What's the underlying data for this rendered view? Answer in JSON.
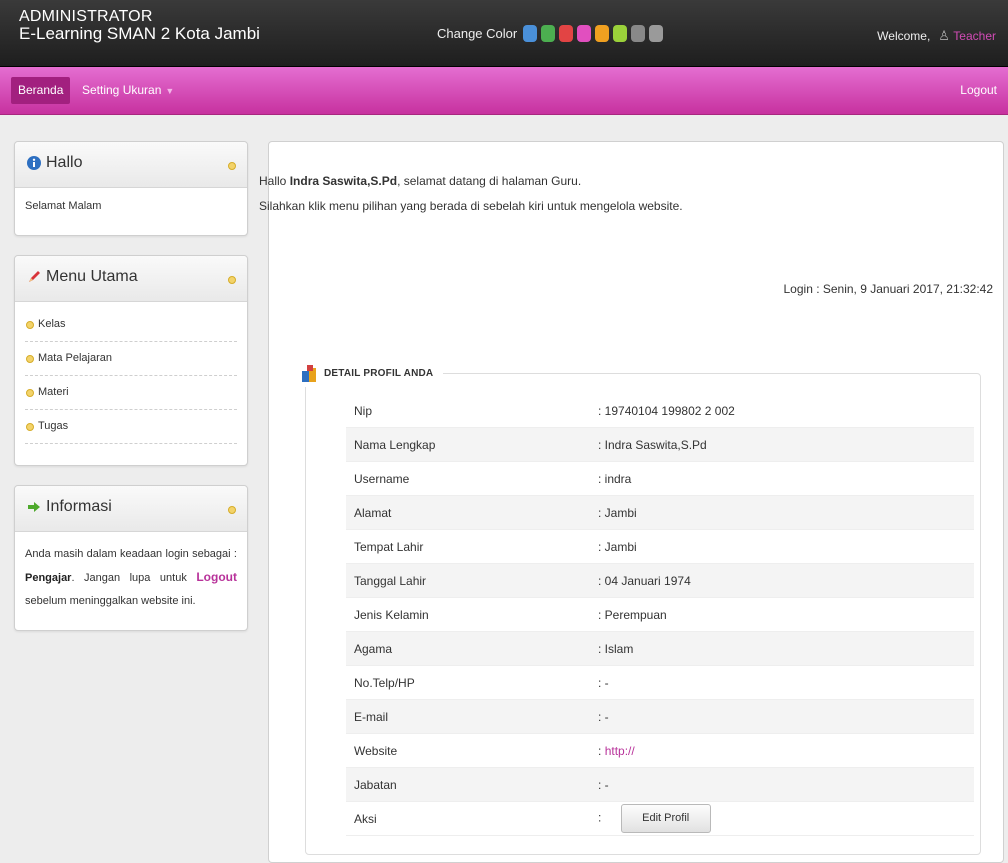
{
  "header": {
    "role": "ADMINISTRATOR",
    "site_name": "E-Learning SMAN 2 Kota Jambi",
    "change_color_label": "Change Color",
    "swatches": [
      "#4a90d9",
      "#4caf50",
      "#e24444",
      "#e14fbf",
      "#f0a020",
      "#9ad13a",
      "#888888",
      "#9a9a9a"
    ],
    "welcome_label": "Welcome,",
    "user_icon": "user-icon",
    "user_name": "Teacher"
  },
  "nav": {
    "home_label": "Beranda",
    "setting_label": "Setting Ukuran",
    "logout_label": "Logout"
  },
  "sidebar": {
    "hallo": {
      "title": "Hallo",
      "text": "Selamat Malam"
    },
    "menu": {
      "title": "Menu Utama",
      "items": [
        {
          "label": "Kelas"
        },
        {
          "label": "Mata Pelajaran"
        },
        {
          "label": "Materi"
        },
        {
          "label": "Tugas"
        }
      ]
    },
    "info": {
      "title": "Informasi",
      "text_before_role": "Anda masih dalam keadaan login sebagai :",
      "role": "Pengajar",
      "text_before_logout": "Jangan lupa untuk",
      "logout": "Logout",
      "text_after_logout": "sebelum meninggalkan website ini."
    }
  },
  "main": {
    "greet_prefix": "Hallo",
    "greet_name": "Indra Saswita,S.Pd",
    "greet_suffix": ", selamat datang di halaman Guru.",
    "greet_line2": "Silahkan klik menu pilihan yang berada di sebelah kiri untuk mengelola website.",
    "login_line": "Login : Senin, 9 Januari 2017, 21:32:42",
    "profile_title": "DETAIL PROFIL ANDA",
    "profile": [
      {
        "key": "Nip",
        "value": ": 19740104 199802 2 002"
      },
      {
        "key": "Nama Lengkap",
        "value": ": Indra Saswita,S.Pd"
      },
      {
        "key": "Username",
        "value": ": indra"
      },
      {
        "key": "Alamat",
        "value": ": Jambi"
      },
      {
        "key": "Tempat Lahir",
        "value": ": Jambi"
      },
      {
        "key": "Tanggal Lahir",
        "value": ": 04 Januari 1974"
      },
      {
        "key": "Jenis Kelamin",
        "value": ": Perempuan"
      },
      {
        "key": "Agama",
        "value": ": Islam"
      },
      {
        "key": "No.Telp/HP",
        "value": ": -"
      },
      {
        "key": "E-mail",
        "value": ": -"
      },
      {
        "key": "Website",
        "value_prefix": ":",
        "value_link": "http://"
      },
      {
        "key": "Jabatan",
        "value": ": -"
      },
      {
        "key": "Aksi",
        "value_prefix": ":",
        "button": "Edit Profil"
      }
    ]
  }
}
